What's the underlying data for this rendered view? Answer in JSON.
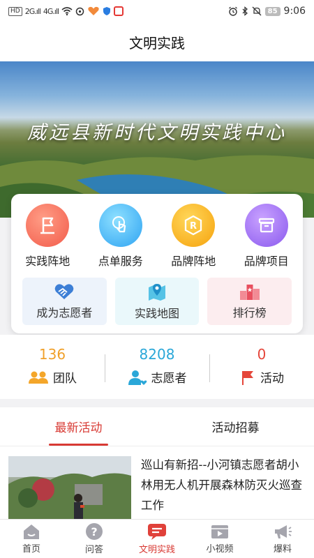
{
  "status_bar": {
    "hd": "HD",
    "signal_1": "2G.ıll",
    "signal_2": "4G.ıll",
    "battery": "85",
    "time": "9:06"
  },
  "header": {
    "title": "文明实践"
  },
  "banner": {
    "title": "威远县新时代文明实践中心"
  },
  "services": [
    {
      "label": "实践阵地",
      "icon": "flag-icon",
      "color": "#f25b4a"
    },
    {
      "label": "点单服务",
      "icon": "tap-icon",
      "color": "#2ea3f2"
    },
    {
      "label": "品牌阵地",
      "icon": "r-badge-icon",
      "color": "#f6a20c"
    },
    {
      "label": "品牌项目",
      "icon": "box-icon",
      "color": "#8a59ee"
    }
  ],
  "quick_links": [
    {
      "label": "成为志愿者",
      "icon": "handshake-icon"
    },
    {
      "label": "实践地图",
      "icon": "map-pin-icon"
    },
    {
      "label": "排行榜",
      "icon": "podium-icon"
    }
  ],
  "stats": [
    {
      "value": "136",
      "label": "团队",
      "icon": "team-icon",
      "color": "#f0a02a"
    },
    {
      "value": "8208",
      "label": "志愿者",
      "icon": "volunteer-icon",
      "color": "#2aa7d8"
    },
    {
      "value": "0",
      "label": "活动",
      "icon": "red-flag-icon",
      "color": "#e5463a"
    }
  ],
  "tabs": [
    {
      "label": "最新活动",
      "active": true
    },
    {
      "label": "活动招募",
      "active": false
    }
  ],
  "news": [
    {
      "title": "巡山有新招--小河镇志愿者胡小林用无人机开展森林防灭火巡查工作"
    }
  ],
  "bottom_nav": [
    {
      "label": "首页",
      "icon": "home-icon",
      "active": false
    },
    {
      "label": "问答",
      "icon": "question-icon",
      "active": false
    },
    {
      "label": "文明实践",
      "icon": "practice-icon",
      "active": true
    },
    {
      "label": "小视频",
      "icon": "video-icon",
      "active": false
    },
    {
      "label": "爆料",
      "icon": "megaphone-icon",
      "active": false
    }
  ]
}
